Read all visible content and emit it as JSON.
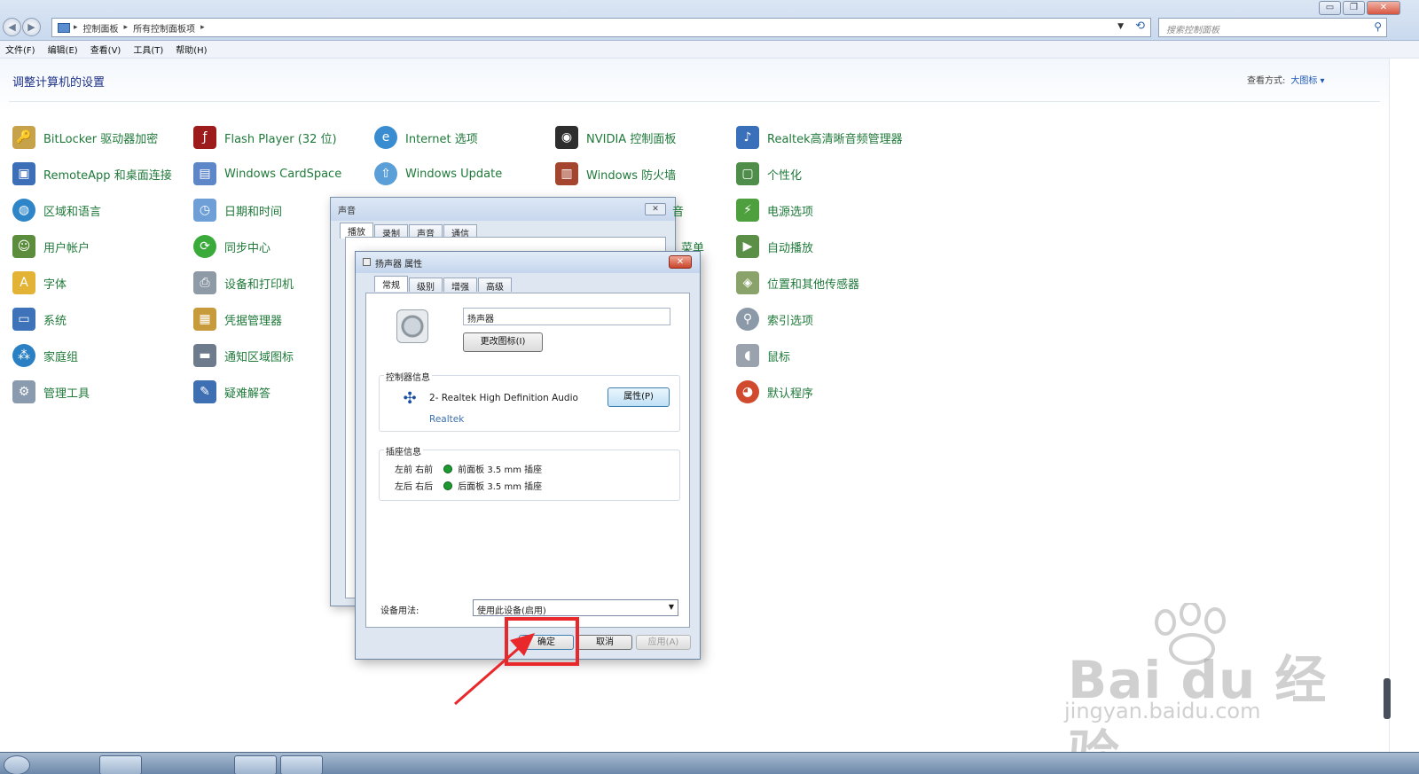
{
  "window": {
    "controls": {
      "minimize": "▭",
      "restore": "❐",
      "close": "✕"
    },
    "address": {
      "crumbs": [
        "控制面板",
        "所有控制面板项"
      ],
      "separator": "▸"
    },
    "search_placeholder": "搜索控制面板",
    "menu": [
      "文件(F)",
      "编辑(E)",
      "查看(V)",
      "工具(T)",
      "帮助(H)"
    ]
  },
  "content": {
    "title": "调整计算机的设置",
    "view_label": "查看方式:",
    "view_value": "大图标 ▾",
    "items": {
      "bitlocker": "BitLocker 驱动器加密",
      "flash": "Flash Player (32 位)",
      "internet": "Internet 选项",
      "nvidia": "NVIDIA 控制面板",
      "realtek": "Realtek高清晰音频管理器",
      "remoteapp": "RemoteApp 和桌面连接",
      "cardspace": "Windows CardSpace",
      "update": "Windows Update",
      "firewall": "Windows 防火墙",
      "personalize": "个性化",
      "region": "区域和语言",
      "datetime": "日期和时间",
      "power": "电源选项",
      "users": "用户帐户",
      "sync": "同步中心",
      "autoplay": "自动播放",
      "fonts": "字体",
      "devices": "设备和打印机",
      "location": "位置和其他传感器",
      "system": "系统",
      "credential": "凭据管理器",
      "indexing": "索引选项",
      "homegroup": "家庭组",
      "tray": "通知区域图标",
      "mouse": "鼠标",
      "admin": "管理工具",
      "troubleshoot": "疑难解答",
      "defaults": "默认程序"
    },
    "partial_labels": {
      "col4_row3": "音",
      "col4_row4": "菜单"
    }
  },
  "sound_dialog": {
    "title": "声音",
    "tabs": [
      "播放",
      "录制",
      "声音",
      "通信"
    ]
  },
  "speaker_dialog": {
    "title": "扬声器 属性",
    "tabs": [
      "常规",
      "级别",
      "增强",
      "高级"
    ],
    "device_name": "扬声器",
    "change_icon_button": "更改图标(I)",
    "controller_group": "控制器信息",
    "controller_name": "2- Realtek High Definition Audio",
    "controller_vendor": "Realtek",
    "properties_button": "属性(P)",
    "jack_group": "插座信息",
    "jacks": [
      {
        "channels": "左前 右前",
        "desc": "前面板 3.5 mm 插座",
        "color": "#1c9a2f"
      },
      {
        "channels": "左后 右后",
        "desc": "后面板 3.5 mm 插座",
        "color": "#1c9a2f"
      }
    ],
    "usage_label": "设备用法:",
    "usage_value": "使用此设备(启用)",
    "ok_button": "确定",
    "cancel_button": "取消",
    "apply_button": "应用(A)"
  },
  "watermark": {
    "brand": "Bai du 经验",
    "url": "jingyan.baidu.com"
  },
  "colors": {
    "link_green": "#1f7a3a",
    "title_blue": "#1e3287",
    "highlight_red": "#e8282b"
  }
}
